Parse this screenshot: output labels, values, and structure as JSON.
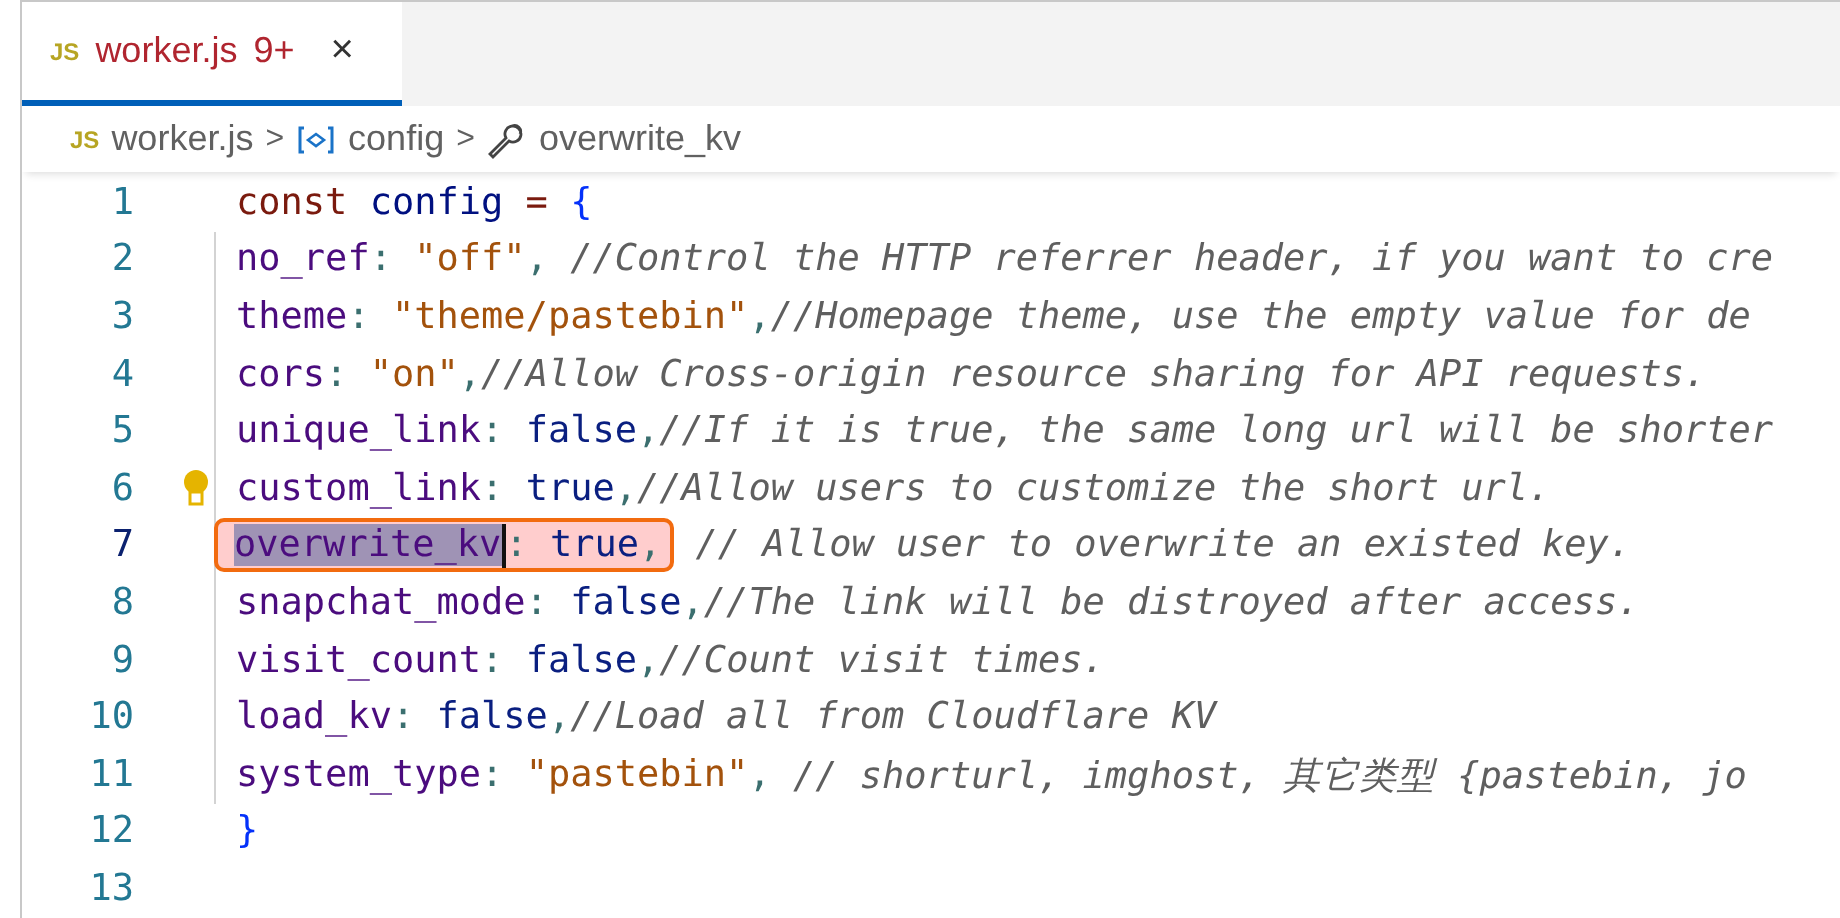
{
  "tab": {
    "icon_text": "JS",
    "name": "worker.js",
    "problems": "9+",
    "close": "×",
    "selected": true
  },
  "breadcrumb": [
    {
      "kind": "file",
      "icon_text": "JS",
      "label": "worker.js"
    },
    {
      "kind": "object",
      "label": "config"
    },
    {
      "kind": "property",
      "label": "overwrite_kv"
    }
  ],
  "breadcrumb_separator": ">",
  "lines": [
    {
      "number": "1",
      "current": false,
      "lightbulb": false,
      "tokens": [
        {
          "kind": "keyword",
          "text": "const "
        },
        {
          "kind": "variable",
          "text": "config"
        },
        {
          "kind": "operator",
          "text": " = "
        },
        {
          "kind": "brace",
          "text": "{"
        }
      ],
      "children": [
        {
          "number": "2",
          "current": false,
          "lightbulb": false,
          "tokens": [
            {
              "kind": "property",
              "text": "no_ref"
            },
            {
              "kind": "punct",
              "text": ": "
            },
            {
              "kind": "string",
              "text": "\"off\""
            },
            {
              "kind": "punct",
              "text": ", "
            },
            {
              "kind": "comment",
              "text": "//Control the HTTP referrer header, if you want to cre"
            }
          ]
        },
        {
          "number": "3",
          "current": false,
          "lightbulb": false,
          "tokens": [
            {
              "kind": "property",
              "text": "theme"
            },
            {
              "kind": "punct",
              "text": ": "
            },
            {
              "kind": "string",
              "text": "\"theme/pastebin\""
            },
            {
              "kind": "punct",
              "text": ","
            },
            {
              "kind": "comment",
              "text": "//Homepage theme, use the empty value for de"
            }
          ]
        },
        {
          "number": "4",
          "current": false,
          "lightbulb": false,
          "tokens": [
            {
              "kind": "property",
              "text": "cors"
            },
            {
              "kind": "punct",
              "text": ": "
            },
            {
              "kind": "string",
              "text": "\"on\""
            },
            {
              "kind": "punct",
              "text": ","
            },
            {
              "kind": "comment",
              "text": "//Allow Cross-origin resource sharing for API requests."
            }
          ]
        },
        {
          "number": "5",
          "current": false,
          "lightbulb": false,
          "tokens": [
            {
              "kind": "property",
              "text": "unique_link"
            },
            {
              "kind": "punct",
              "text": ": "
            },
            {
              "kind": "boolean",
              "text": "false"
            },
            {
              "kind": "punct",
              "text": ","
            },
            {
              "kind": "comment",
              "text": "//If it is true, the same long url will be shorter"
            }
          ]
        },
        {
          "number": "6",
          "current": false,
          "lightbulb": true,
          "tokens": [
            {
              "kind": "property",
              "text": "custom_link"
            },
            {
              "kind": "punct",
              "text": ": "
            },
            {
              "kind": "boolean",
              "text": "true"
            },
            {
              "kind": "punct",
              "text": ","
            },
            {
              "kind": "comment",
              "text": "//Allow users to customize the short url."
            }
          ]
        },
        {
          "number": "7",
          "current": true,
          "lightbulb": false,
          "tokens": [
            {
              "kind": "property",
              "text": "overwrite_kv",
              "selected": true,
              "boxed": true
            },
            {
              "kind": "punct",
              "text": ": ",
              "boxed": true
            },
            {
              "kind": "boolean",
              "text": "true",
              "boxed": true
            },
            {
              "kind": "punct",
              "text": ",",
              "boxed": true
            },
            {
              "kind": "comment",
              "text": " // Allow user to overwrite an existed key."
            }
          ]
        },
        {
          "number": "8",
          "current": false,
          "lightbulb": false,
          "tokens": [
            {
              "kind": "property",
              "text": "snapchat_mode"
            },
            {
              "kind": "punct",
              "text": ": "
            },
            {
              "kind": "boolean",
              "text": "false"
            },
            {
              "kind": "punct",
              "text": ","
            },
            {
              "kind": "comment",
              "text": "//The link will be distroyed after access."
            }
          ]
        },
        {
          "number": "9",
          "current": false,
          "lightbulb": false,
          "tokens": [
            {
              "kind": "property",
              "text": "visit_count"
            },
            {
              "kind": "punct",
              "text": ": "
            },
            {
              "kind": "boolean",
              "text": "false"
            },
            {
              "kind": "punct",
              "text": ","
            },
            {
              "kind": "comment",
              "text": "//Count visit times."
            }
          ]
        },
        {
          "number": "10",
          "current": false,
          "lightbulb": false,
          "tokens": [
            {
              "kind": "property",
              "text": "load_kv"
            },
            {
              "kind": "punct",
              "text": ": "
            },
            {
              "kind": "boolean",
              "text": "false"
            },
            {
              "kind": "punct",
              "text": ","
            },
            {
              "kind": "comment",
              "text": "//Load all from Cloudflare KV"
            }
          ]
        },
        {
          "number": "11",
          "current": false,
          "lightbulb": false,
          "tokens": [
            {
              "kind": "property",
              "text": "system_type"
            },
            {
              "kind": "punct",
              "text": ": "
            },
            {
              "kind": "string",
              "text": "\"pastebin\""
            },
            {
              "kind": "punct",
              "text": ", "
            },
            {
              "kind": "comment",
              "text": "// shorturl, imghost, 其它类型 {pastebin, jo"
            }
          ]
        }
      ]
    },
    {
      "number": "12",
      "current": false,
      "lightbulb": false,
      "tokens": [
        {
          "kind": "brace",
          "text": "}"
        }
      ]
    },
    {
      "number": "13",
      "current": false,
      "lightbulb": false
    }
  ]
}
